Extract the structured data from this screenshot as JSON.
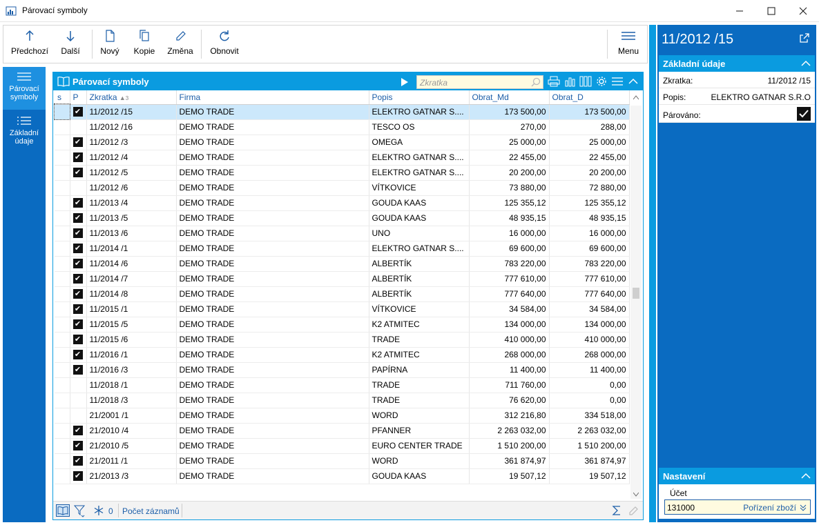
{
  "window": {
    "title": "Párovací symboly",
    "minimize": "—",
    "maximize": "☐",
    "close": "✕"
  },
  "toolbar": {
    "prev": "Předchozí",
    "next": "Další",
    "new": "Nový",
    "copy": "Kopie",
    "edit": "Změna",
    "refresh": "Obnovit",
    "menu": "Menu"
  },
  "leftnav": {
    "items": [
      {
        "label": "Párovací symboly"
      },
      {
        "label": "Základní údaje"
      }
    ]
  },
  "grid": {
    "title": "Párovací symboly",
    "search_placeholder": "Zkratka",
    "columns": [
      "s",
      "P",
      "Zkratka",
      "Firma",
      "Popis",
      "Obrat_Md",
      "Obrat_D"
    ],
    "sort_indicator": "▲",
    "sort_index": "3",
    "rows": [
      {
        "p": true,
        "zkratka": "11/2012 /15",
        "firma": "DEMO TRADE",
        "popis": "ELEKTRO GATNAR S....",
        "md": "173 500,00",
        "d": "173 500,00"
      },
      {
        "p": false,
        "zkratka": "11/2012 /16",
        "firma": "DEMO TRADE",
        "popis": "TESCO OS",
        "md": "270,00",
        "d": "288,00"
      },
      {
        "p": true,
        "zkratka": "11/2012 /3",
        "firma": "DEMO TRADE",
        "popis": "OMEGA",
        "md": "25 000,00",
        "d": "25 000,00"
      },
      {
        "p": true,
        "zkratka": "11/2012 /4",
        "firma": "DEMO TRADE",
        "popis": "ELEKTRO GATNAR S....",
        "md": "22 455,00",
        "d": "22 455,00"
      },
      {
        "p": true,
        "zkratka": "11/2012 /5",
        "firma": "DEMO TRADE",
        "popis": "ELEKTRO GATNAR S....",
        "md": "20 200,00",
        "d": "20 200,00"
      },
      {
        "p": false,
        "zkratka": "11/2012 /6",
        "firma": "DEMO TRADE",
        "popis": "VÍTKOVICE",
        "md": "73 880,00",
        "d": "72 880,00"
      },
      {
        "p": true,
        "zkratka": "11/2013 /4",
        "firma": "DEMO TRADE",
        "popis": "GOUDA KAAS",
        "md": "125 355,12",
        "d": "125 355,12"
      },
      {
        "p": true,
        "zkratka": "11/2013 /5",
        "firma": "DEMO TRADE",
        "popis": "GOUDA KAAS",
        "md": "48 935,15",
        "d": "48 935,15"
      },
      {
        "p": true,
        "zkratka": "11/2013 /6",
        "firma": "DEMO TRADE",
        "popis": "UNO",
        "md": "16 000,00",
        "d": "16 000,00"
      },
      {
        "p": true,
        "zkratka": "11/2014 /1",
        "firma": "DEMO TRADE",
        "popis": "ELEKTRO GATNAR S....",
        "md": "69 600,00",
        "d": "69 600,00"
      },
      {
        "p": true,
        "zkratka": "11/2014 /6",
        "firma": "DEMO TRADE",
        "popis": "ALBERTÍK",
        "md": "783 220,00",
        "d": "783 220,00"
      },
      {
        "p": true,
        "zkratka": "11/2014 /7",
        "firma": "DEMO TRADE",
        "popis": "ALBERTÍK",
        "md": "777 610,00",
        "d": "777 610,00"
      },
      {
        "p": true,
        "zkratka": "11/2014 /8",
        "firma": "DEMO TRADE",
        "popis": "ALBERTÍK",
        "md": "777 640,00",
        "d": "777 640,00"
      },
      {
        "p": true,
        "zkratka": "11/2015 /1",
        "firma": "DEMO TRADE",
        "popis": "VÍTKOVICE",
        "md": "34 584,00",
        "d": "34 584,00"
      },
      {
        "p": true,
        "zkratka": "11/2015 /5",
        "firma": "DEMO TRADE",
        "popis": "K2 ATMITEC",
        "md": "134 000,00",
        "d": "134 000,00"
      },
      {
        "p": true,
        "zkratka": "11/2015 /6",
        "firma": "DEMO TRADE",
        "popis": "TRADE",
        "md": "410 000,00",
        "d": "410 000,00"
      },
      {
        "p": true,
        "zkratka": "11/2016 /1",
        "firma": "DEMO TRADE",
        "popis": "K2 ATMITEC",
        "md": "268 000,00",
        "d": "268 000,00"
      },
      {
        "p": true,
        "zkratka": "11/2016 /3",
        "firma": "DEMO TRADE",
        "popis": "PAPÍRNA",
        "md": "11 400,00",
        "d": "11 400,00"
      },
      {
        "p": false,
        "zkratka": "11/2018 /1",
        "firma": "DEMO TRADE",
        "popis": "TRADE",
        "md": "711 760,00",
        "d": "0,00"
      },
      {
        "p": false,
        "zkratka": "11/2018 /3",
        "firma": "DEMO TRADE",
        "popis": "TRADE",
        "md": "76 620,00",
        "d": "0,00"
      },
      {
        "p": false,
        "zkratka": "21/2001 /1",
        "firma": "DEMO TRADE",
        "popis": "WORD",
        "md": "312 216,80",
        "d": "334 518,00"
      },
      {
        "p": true,
        "zkratka": "21/2010 /4",
        "firma": "DEMO TRADE",
        "popis": "PFANNER",
        "md": "2 263 032,00",
        "d": "2 263 032,00"
      },
      {
        "p": true,
        "zkratka": "21/2010 /5",
        "firma": "DEMO TRADE",
        "popis": "EURO CENTER TRADE",
        "md": "1 510 200,00",
        "d": "1 510 200,00"
      },
      {
        "p": true,
        "zkratka": "21/2011 /1",
        "firma": "DEMO TRADE",
        "popis": "WORD",
        "md": "361 874,97",
        "d": "361 874,97"
      },
      {
        "p": true,
        "zkratka": "21/2013 /3",
        "firma": "DEMO TRADE",
        "popis": "GOUDA KAAS",
        "md": "19 507,12",
        "d": "19 507,12"
      }
    ],
    "selected_index": 0,
    "status": {
      "filter_count": "0",
      "record_count_label": "Počet záznamů"
    }
  },
  "detail": {
    "title": "11/2012 /15",
    "basic_section": "Základní údaje",
    "zkratka_label": "Zkratka:",
    "zkratka_value": "11/2012 /15",
    "popis_label": "Popis:",
    "popis_value": "ELEKTRO GATNAR S.R.O",
    "parovano_label": "Párováno:",
    "parovano_value": true,
    "settings_section": "Nastavení",
    "ucet_label": "Účet",
    "ucet_value": "131000",
    "ucet_hint": "Pořízení zboží"
  },
  "colors": {
    "accent_dark": "#0a6bc1",
    "accent": "#0a9be0",
    "selection": "#cce8fb",
    "header_text": "#1c5ea8"
  }
}
